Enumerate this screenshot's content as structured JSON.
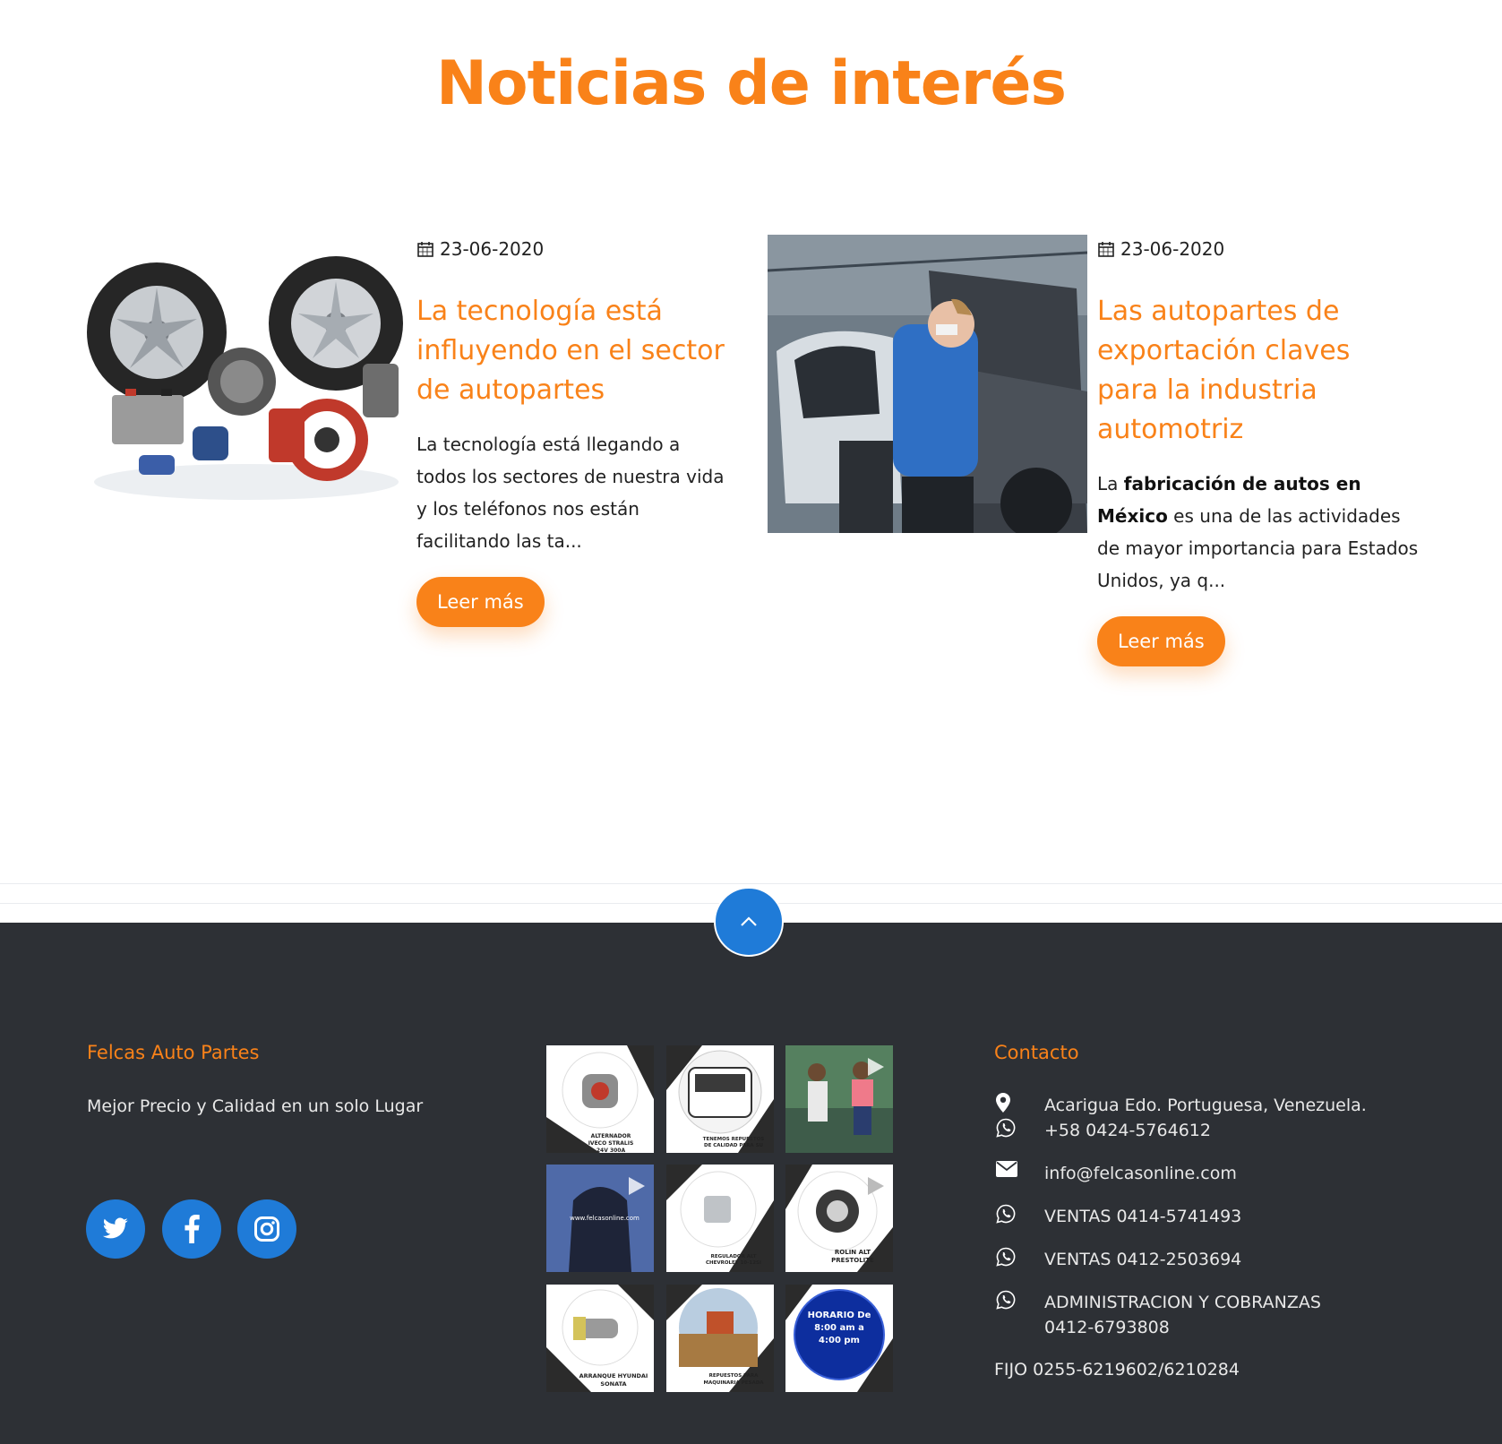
{
  "section": {
    "title": "Noticias de interés"
  },
  "news": [
    {
      "date": "23-06-2020",
      "title": "La tecnología está influyendo en el sector de autopartes",
      "excerpt": "La tecnología está llegando a todos los sectores de nuestra vida y los teléfonos nos están facilitando las ta...",
      "button": "Leer más",
      "image": "auto-parts-photo"
    },
    {
      "date": "23-06-2020",
      "title": "Las autopartes de exportación claves para la industria automotriz",
      "excerpt_prefix": "La ",
      "excerpt_bold": "fabricación de autos en México",
      "excerpt_rest": " es una de las actividades de mayor importancia para Estados Unidos, ya q...",
      "button": "Leer más",
      "image": "car-factory-worker-photo"
    }
  ],
  "footer": {
    "brand_title": "Felcas Auto Partes",
    "tagline": "Mejor Precio y Calidad en un solo Lugar",
    "social": [
      "twitter-icon",
      "facebook-icon",
      "instagram-icon"
    ],
    "instagram_captions": [
      "ALTERNADOR IVECO STRALIS 24V 300A",
      "TENEMOS REPUESTOS DE CALIDAD PARA SU",
      "",
      "www.felcasonline.com",
      "REGULADOR ALT CHEVROLET 10-12SI",
      "ROLIN ALT PRESTOLITE",
      "ARRANQUE HYUNDAI SONATA",
      "REPUESTOS PARA MAQUINARIA PESADA",
      "HORARIO De 8:00 am a 4:00 pm"
    ],
    "contact_title": "Contacto",
    "contact": {
      "address": "Acarigua Edo. Portuguesa, Venezuela.",
      "phone": "+58 0424-5764612",
      "email": "info@felcasonline.com",
      "ventas1": "VENTAS 0414-5741493",
      "ventas2": "VENTAS 0412-2503694",
      "admin_line1": "ADMINISTRACION Y COBRANZAS",
      "admin_line2": "0412-6793808",
      "fijo": "FIJO 0255-6219602/6210284"
    }
  },
  "colors": {
    "accent": "#f98219",
    "blue": "#1f7bd8",
    "footer_bg": "#2d3035"
  }
}
